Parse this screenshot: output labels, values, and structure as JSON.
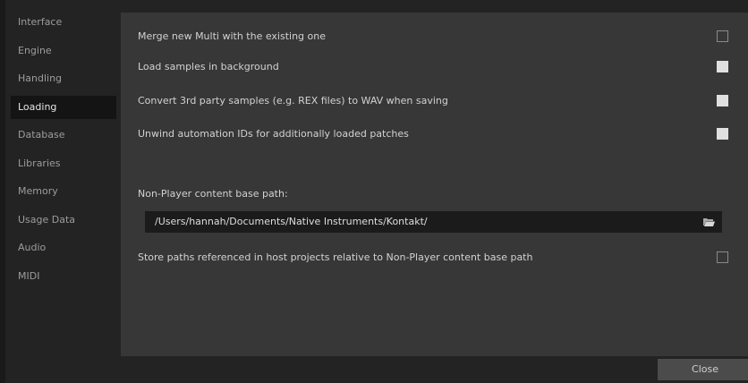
{
  "sidebar": {
    "items": [
      {
        "label": "Interface",
        "active": false
      },
      {
        "label": "Engine",
        "active": false
      },
      {
        "label": "Handling",
        "active": false
      },
      {
        "label": "Loading",
        "active": true
      },
      {
        "label": "Database",
        "active": false
      },
      {
        "label": "Libraries",
        "active": false
      },
      {
        "label": "Memory",
        "active": false
      },
      {
        "label": "Usage Data",
        "active": false
      },
      {
        "label": "Audio",
        "active": false
      },
      {
        "label": "MIDI",
        "active": false
      }
    ]
  },
  "options": [
    {
      "label": "Merge new Multi with the existing one",
      "checked": false
    },
    {
      "label": "Load samples in background",
      "checked": true
    },
    {
      "label": "Convert 3rd party samples (e.g. REX files) to WAV when saving",
      "checked": true
    },
    {
      "label": "Unwind automation IDs for additionally loaded patches",
      "checked": true
    }
  ],
  "content_path": {
    "label": "Non-Player content base path:",
    "value": "/Users/hannah/Documents/Native Instruments/Kontakt/",
    "browse_icon": "folder-icon"
  },
  "relative_paths": {
    "label": "Store paths referenced in host projects relative to Non-Player content base path",
    "checked": false
  },
  "footer": {
    "close_label": "Close"
  }
}
